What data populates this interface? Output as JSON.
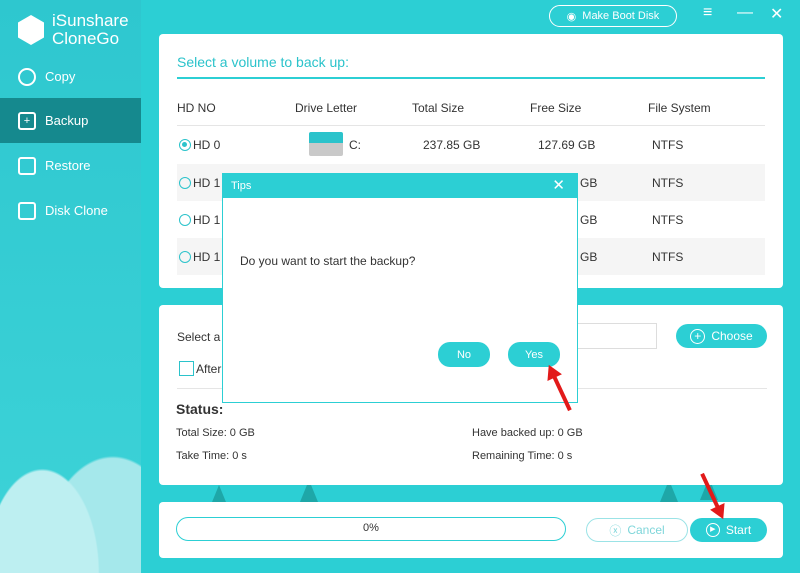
{
  "app": {
    "brand_line1": "iSunshare",
    "brand_line2": "CloneGo",
    "make_boot_disk": "Make Boot Disk"
  },
  "sidebar": {
    "items": [
      {
        "label": "Copy"
      },
      {
        "label": "Backup"
      },
      {
        "label": "Restore"
      },
      {
        "label": "Disk Clone"
      }
    ]
  },
  "volumes": {
    "title": "Select a volume to back up:",
    "headers": [
      "HD NO",
      "Drive Letter",
      "Total Size",
      "Free Size",
      "File System"
    ],
    "rows": [
      {
        "hd": "HD 0",
        "letter": "C:",
        "total": "237.85 GB",
        "free": "127.69 GB",
        "fs": "NTFS",
        "selected": true
      },
      {
        "hd": "HD 1",
        "letter": "",
        "total": "",
        "free": "GB",
        "fs": "NTFS",
        "selected": false
      },
      {
        "hd": "HD 1",
        "letter": "",
        "total": "",
        "free": "GB",
        "fs": "NTFS",
        "selected": false
      },
      {
        "hd": "HD 1",
        "letter": "",
        "total": "",
        "free": "GB",
        "fs": "NTFS",
        "selected": false
      }
    ]
  },
  "target": {
    "label": "Select a",
    "choose": "Choose",
    "after_label": "After"
  },
  "status": {
    "title": "Status:",
    "total_size": "Total Size: 0 GB",
    "take_time": "Take Time: 0 s",
    "have_backed_up": "Have backed up: 0 GB",
    "remaining_time": "Remaining Time: 0 s"
  },
  "progress": {
    "value": 0,
    "label": "0%",
    "cancel": "Cancel",
    "start": "Start"
  },
  "dialog": {
    "title": "Tips",
    "message": "Do you want to start the backup?",
    "no": "No",
    "yes": "Yes"
  }
}
